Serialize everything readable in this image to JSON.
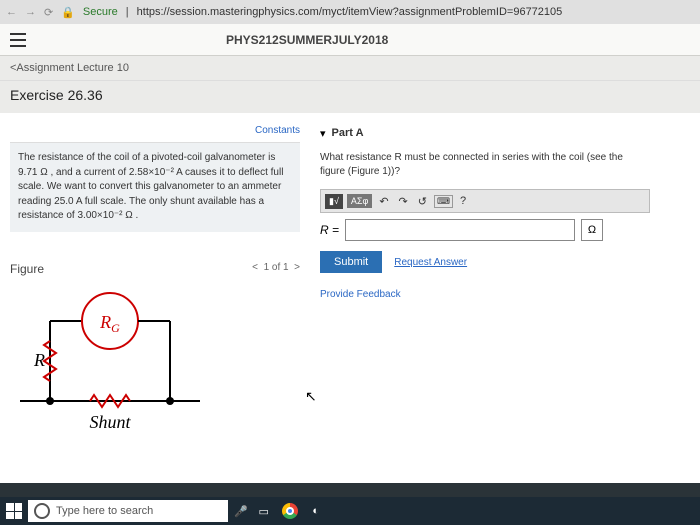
{
  "browser": {
    "secure_label": "Secure",
    "url": "https://session.masteringphysics.com/myct/itemView?assignmentProblemID=96772105"
  },
  "header": {
    "course": "PHYS212SUMMERJULY2018"
  },
  "crumb": "<Assignment Lecture 10",
  "exercise_title": "Exercise 26.36",
  "constants_link": "Constants",
  "description": "The resistance of the coil of a pivoted-coil galvanometer is 9.71 Ω , and a current of 2.58×10⁻² A causes it to deflect full scale. We want to convert this galvanometer to an ammeter reading 25.0 A full scale. The only shunt available has a resistance of 3.00×10⁻² Ω .",
  "partA": {
    "label": "Part A",
    "question": "What resistance R must be connected in series with the coil (see the figure (Figure 1))?",
    "R_eq": "R =",
    "unit": "Ω",
    "submit_label": "Submit",
    "request_label": "Request Answer",
    "feedback_label": "Provide Feedback",
    "toolbar_sigma": "ΑΣφ"
  },
  "figure": {
    "label": "Figure",
    "nav": "1 of 1",
    "R_label": "R",
    "RG_label": "RG",
    "shunt_label": "Shunt"
  },
  "taskbar": {
    "search_placeholder": "Type here to search"
  }
}
